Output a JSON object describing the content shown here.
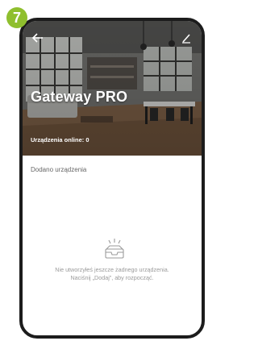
{
  "step_badge": "7",
  "header": {
    "title": "Gateway PRO",
    "online_label": "Urządzenia online: 0"
  },
  "icons": {
    "back": "arrow-left-icon",
    "edit": "pencil-icon",
    "empty": "empty-tray-icon"
  },
  "content": {
    "section_label": "Dodano urządzenia",
    "empty_line1": "Nie utworzyłeś jeszcze żadnego urządzenia.",
    "empty_line2": "Naciśnij „Dodaj”, aby rozpocząć."
  },
  "colors": {
    "badge": "#8fbf2e",
    "frame": "#1c1c1c"
  }
}
